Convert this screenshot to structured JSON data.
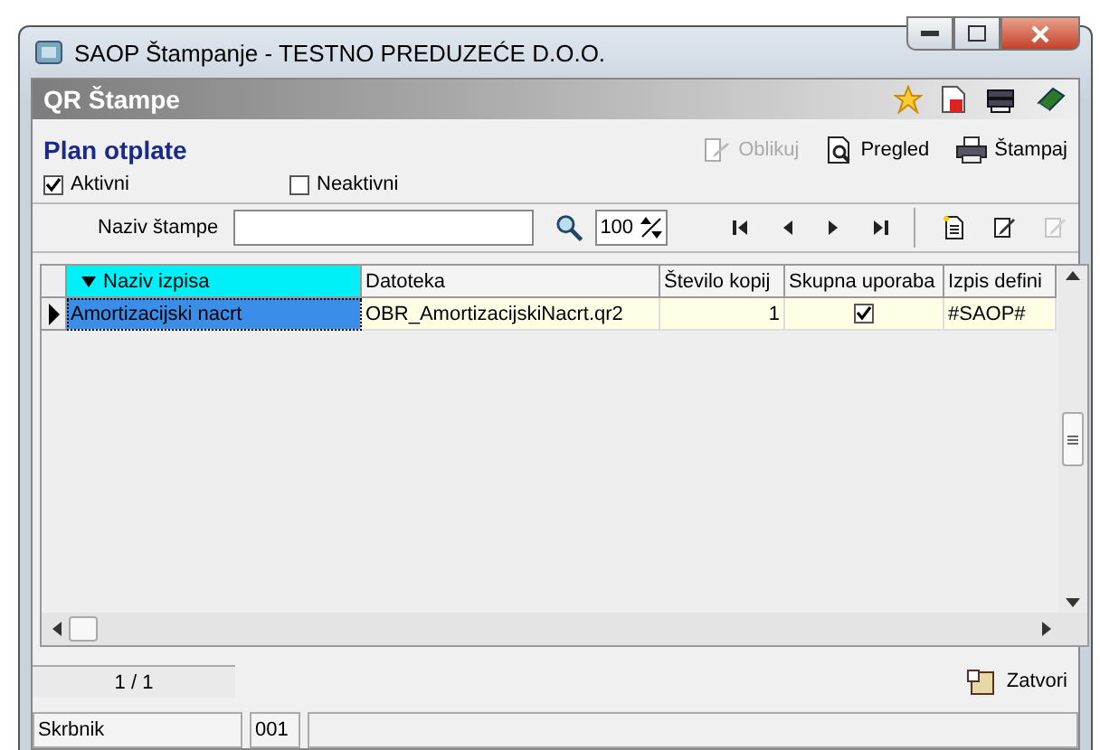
{
  "window": {
    "title": "SAOP Štampanje - TESTNO PREDUZEĆE D.O.O."
  },
  "panel": {
    "title": "QR Štampe"
  },
  "section": {
    "title": "Plan otplate"
  },
  "actions": [
    {
      "kind": "design",
      "label": "Oblikuj",
      "disabled": true
    },
    {
      "kind": "preview",
      "label": "Pregled",
      "disabled": false
    },
    {
      "kind": "print",
      "label": "Štampaj",
      "disabled": false
    }
  ],
  "filters": [
    {
      "label": "Aktivni",
      "checked": true
    },
    {
      "label": "Neaktivni",
      "checked": false
    }
  ],
  "search": {
    "label": "Naziv štampe",
    "zoom": "100"
  },
  "nav_tools": [
    {
      "kind": "first",
      "disabled": false
    },
    {
      "kind": "prev",
      "disabled": false
    },
    {
      "kind": "next",
      "disabled": false
    },
    {
      "kind": "last",
      "disabled": false
    },
    {
      "kind": "new",
      "disabled": false
    },
    {
      "kind": "edit",
      "disabled": false
    },
    {
      "kind": "delete",
      "disabled": true
    }
  ],
  "table": {
    "columns": [
      {
        "label": "Naziv izpisa",
        "sorted": true
      },
      {
        "label": "Datoteka",
        "sorted": false
      },
      {
        "label": "Število kopij",
        "sorted": false
      },
      {
        "label": "Skupna uporaba",
        "sorted": false
      },
      {
        "label": "Izpis defini",
        "sorted": false
      }
    ],
    "rows": [
      {
        "selected": true,
        "name": "Amortizacijski nacrt",
        "file": "OBR_AmortizacijskiNacrt.qr2",
        "copies": "1",
        "shared": true,
        "defined_by": "#SAOP#"
      }
    ]
  },
  "pager": "1 / 1",
  "close_button": "Zatvori",
  "status_bar": [
    "Skrbnik",
    "001"
  ]
}
